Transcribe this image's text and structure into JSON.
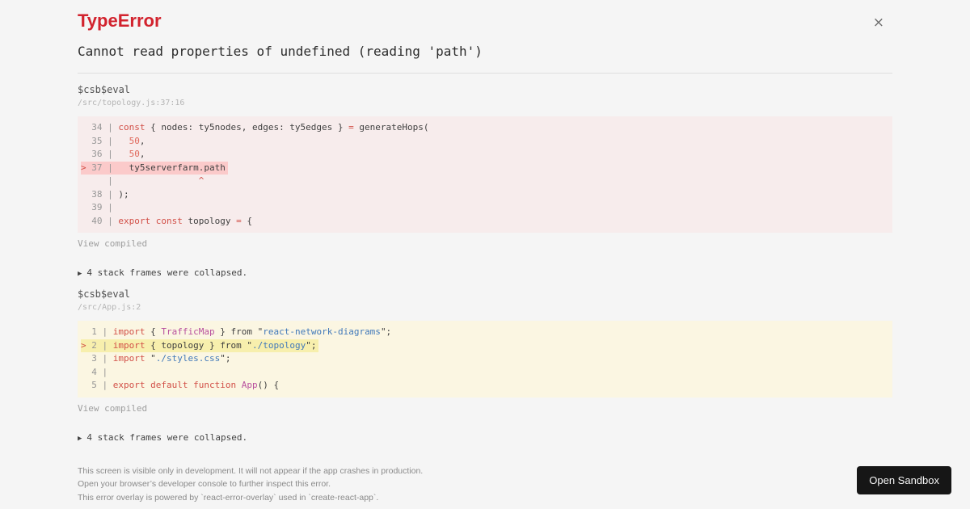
{
  "header": {
    "title": "TypeError",
    "close_icon": "×",
    "message": "Cannot read properties of undefined (reading 'path')"
  },
  "frames": [
    {
      "function": "$csb$eval",
      "location": "/src/topology.js:37:16",
      "variant": "error",
      "view_compiled_label": "View compiled",
      "expander_icon": "▶",
      "collapsed_label": "4 stack frames were collapsed.",
      "code": [
        {
          "mark": "",
          "no": " 34",
          "hl": false,
          "seg": [
            [
              "const",
              "keyword"
            ],
            [
              " { nodes: ty5nodes, edges: ty5edges } ",
              "plain"
            ],
            [
              "=",
              "keyword"
            ],
            [
              " generateHops(",
              "plain"
            ]
          ]
        },
        {
          "mark": "",
          "no": " 35",
          "hl": false,
          "seg": [
            [
              "  ",
              "plain"
            ],
            [
              "50",
              "number"
            ],
            [
              ",",
              "plain"
            ]
          ]
        },
        {
          "mark": "",
          "no": " 36",
          "hl": false,
          "seg": [
            [
              "  ",
              "plain"
            ],
            [
              "50",
              "number"
            ],
            [
              ",",
              "plain"
            ]
          ]
        },
        {
          "mark": ">",
          "no": " 37",
          "hl": true,
          "seg": [
            [
              "  ty5serverfarm.path",
              "plain"
            ]
          ]
        },
        {
          "mark": "",
          "no": "   ",
          "hl": false,
          "seg": [
            [
              "               ^",
              "caret"
            ]
          ]
        },
        {
          "mark": "",
          "no": " 38",
          "hl": false,
          "seg": [
            [
              ");",
              "plain"
            ]
          ]
        },
        {
          "mark": "",
          "no": " 39",
          "hl": false,
          "seg": []
        },
        {
          "mark": "",
          "no": " 40",
          "hl": false,
          "seg": [
            [
              "export",
              "keyword"
            ],
            [
              " ",
              "plain"
            ],
            [
              "const",
              "keyword"
            ],
            [
              " topology ",
              "plain"
            ],
            [
              "=",
              "keyword"
            ],
            [
              " {",
              "plain"
            ]
          ]
        }
      ]
    },
    {
      "function": "$csb$eval",
      "location": "/src/App.js:2",
      "variant": "warning",
      "view_compiled_label": "View compiled",
      "expander_icon": "▶",
      "collapsed_label": "4 stack frames were collapsed.",
      "code": [
        {
          "mark": "",
          "no": " 1",
          "hl": false,
          "seg": [
            [
              "import",
              "keyword"
            ],
            [
              " { ",
              "plain"
            ],
            [
              "TrafficMap",
              "name"
            ],
            [
              " } ",
              "plain"
            ],
            [
              "from",
              "plain"
            ],
            [
              " \"",
              "plain"
            ],
            [
              "react-network-diagrams",
              "string"
            ],
            [
              "\";",
              "plain"
            ]
          ]
        },
        {
          "mark": ">",
          "no": " 2",
          "hl": true,
          "seg": [
            [
              "import",
              "keyword"
            ],
            [
              " { topology } ",
              "plain"
            ],
            [
              "from",
              "plain"
            ],
            [
              " \"",
              "plain"
            ],
            [
              "./topology",
              "string"
            ],
            [
              "\";",
              "plain"
            ]
          ]
        },
        {
          "mark": "",
          "no": " 3",
          "hl": false,
          "seg": [
            [
              "import",
              "keyword"
            ],
            [
              " \"",
              "plain"
            ],
            [
              "./styles.css",
              "string"
            ],
            [
              "\";",
              "plain"
            ]
          ]
        },
        {
          "mark": "",
          "no": " 4",
          "hl": false,
          "seg": []
        },
        {
          "mark": "",
          "no": " 5",
          "hl": false,
          "seg": [
            [
              "export",
              "keyword"
            ],
            [
              " ",
              "plain"
            ],
            [
              "default",
              "keyword"
            ],
            [
              " ",
              "plain"
            ],
            [
              "function",
              "keyword"
            ],
            [
              " ",
              "plain"
            ],
            [
              "App",
              "name"
            ],
            [
              "() {",
              "plain"
            ]
          ]
        }
      ]
    }
  ],
  "footer": {
    "lines": [
      "This screen is visible only in development. It will not appear if the app crashes in production.",
      "Open your browser’s developer console to further inspect this error.",
      "This error overlay is powered by `react-error-overlay` used in `create-react-app`."
    ]
  },
  "open_sandbox_button": {
    "label": "Open Sandbox"
  },
  "colors": {
    "page_bg": "#f5f5f5",
    "title_red": "#d2232e",
    "error_block_bg": "#f7ecec",
    "error_line_highlight": "#fbcaca",
    "warning_block_bg": "#fbf6e2",
    "warning_line_highlight": "#f7efad",
    "keyword": "#d25048",
    "string": "#4179ba",
    "identifier": "#b8509e",
    "button_bg": "#161616"
  }
}
